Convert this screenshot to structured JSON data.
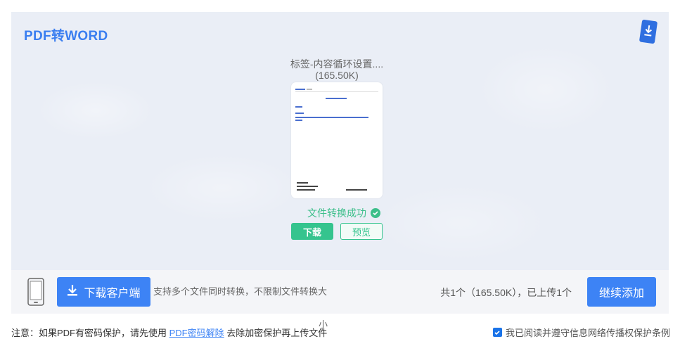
{
  "header": {
    "title": "PDF转WORD"
  },
  "icons": {
    "badge": "download-badge-icon",
    "phone": "mobile-phone-icon",
    "download": "download-arrow-icon",
    "check": "check-circle-icon"
  },
  "file": {
    "name": "标签-内容循环设置....",
    "size": "(165.50K)",
    "status": "文件转换成功",
    "download_label": "下载",
    "preview_label": "预览"
  },
  "bottom": {
    "client_label": "下载客户端",
    "support_line1": "支持多个文件同时转换，不限制文件转换大",
    "support_line2": "小",
    "count": "共1个（165.50K），已上传1个",
    "continue_label": "继续添加"
  },
  "footer": {
    "note_prefix": "注意：如果PDF有密码保护，请先使用 ",
    "note_link": "PDF密码解除",
    "note_suffix": " 去除加密保护再上传文件",
    "agreement": "我已阅读并遵守信息网络传播权保护条例",
    "agreement_checked": true
  },
  "colors": {
    "accent": "#3d83f5",
    "success": "#35c48e",
    "title": "#3a7ef0"
  }
}
